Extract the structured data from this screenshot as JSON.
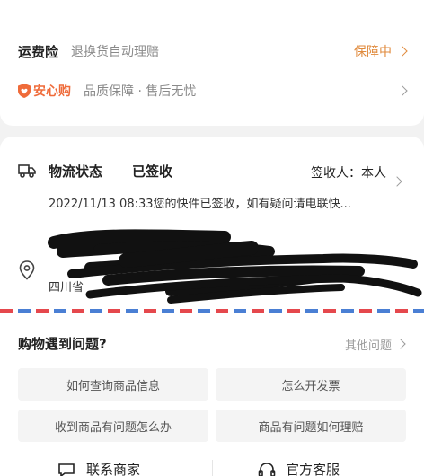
{
  "shipping_insurance": {
    "title": "运费险",
    "description": "退换货自动理赔",
    "status": "保障中"
  },
  "secure_purchase": {
    "badge": "安心购",
    "description": "品质保障 · 售后无忧"
  },
  "logistics": {
    "label": "物流状态",
    "status": "已签收",
    "receiver": "签收人：本人",
    "detail": "2022/11/13 08:33您的快件已签收，如有疑问请电联快..."
  },
  "address": {
    "province": "四川省"
  },
  "help": {
    "title": "购物遇到问题?",
    "more": "其他问题",
    "questions": [
      "如何查询商品信息",
      "怎么开发票",
      "收到商品有问题怎么办",
      "商品有问题如何理赔"
    ]
  },
  "bottom_actions": {
    "contact_merchant": "联系商家",
    "official_service": "官方客服"
  },
  "colors": {
    "accent_orange": "#e08a3c",
    "badge_red": "#ef6b3a",
    "airmail_red": "#e5484d",
    "airmail_blue": "#4a7fd4"
  }
}
